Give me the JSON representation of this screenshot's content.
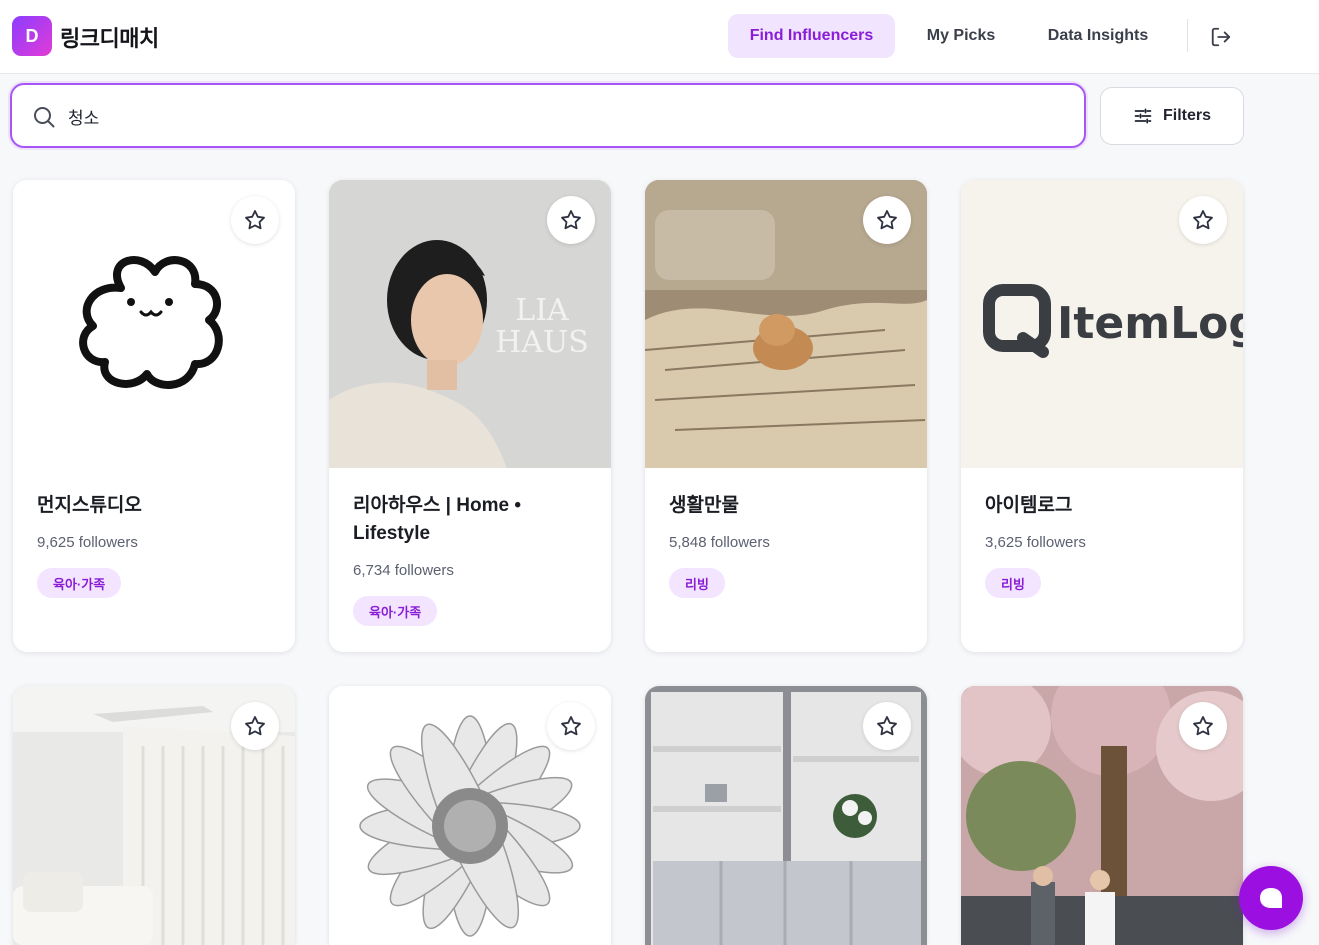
{
  "app": {
    "logo_letter": "D",
    "name": "링크디매치"
  },
  "nav": {
    "find_influencers": "Find Influencers",
    "my_picks": "My Picks",
    "data_insights": "Data Insights"
  },
  "search": {
    "value": "청소"
  },
  "filters": {
    "label": "Filters"
  },
  "cards": [
    {
      "name": "먼지스튜디오",
      "followers": "9,625 followers",
      "tag": "육아·가족"
    },
    {
      "name": "리아하우스 | Home • Lifestyle",
      "followers": "6,734 followers",
      "tag": "육아·가족",
      "image_text_1": "LIA",
      "image_text_2": "HAUS"
    },
    {
      "name": "생활만물",
      "followers": "5,848 followers",
      "tag": "리빙"
    },
    {
      "name": "아이템로그",
      "followers": "3,625 followers",
      "tag": "리빙",
      "image_text": "ItemLog"
    }
  ],
  "colors": {
    "accent": "#8a1ed6",
    "accent_light": "#f1e4ff",
    "search_border": "#a855f7",
    "fab": "#9b0fe0"
  }
}
